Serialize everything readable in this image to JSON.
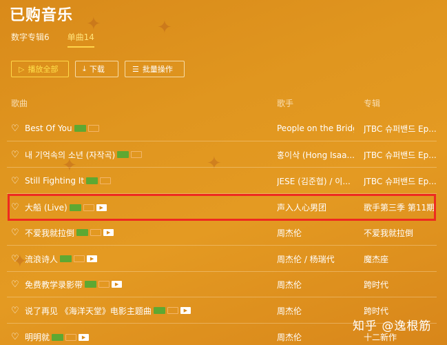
{
  "header": {
    "title": "已购音乐"
  },
  "tabs": [
    {
      "label": "数字专辑6"
    },
    {
      "label": "单曲14"
    }
  ],
  "toolbar": {
    "play_all": "播放全部",
    "download": "下载",
    "batch": "批量操作"
  },
  "columns": {
    "song": "歌曲",
    "singer": "歌手",
    "album": "专辑"
  },
  "songs": [
    {
      "title": "Best Of You",
      "singer": "People on the Bridge",
      "album": "JTBC 슈퍼밴드 Ep..."
    },
    {
      "title": "내 기억속의 소년 (자작곡)",
      "singer": "홍이삭 (Hong Isaa...",
      "album": "JTBC 슈퍼밴드 Ep..."
    },
    {
      "title": "Still Fighting It",
      "singer": "JESE (김준협) / 이...",
      "album": "JTBC 슈퍼밴드 Ep..."
    },
    {
      "title": "大船 (Live)",
      "singer": "声入人心男团",
      "album": "歌手第三季 第11期"
    },
    {
      "title": "不爱我就拉倒",
      "singer": "周杰伦",
      "album": "不爱我就拉倒"
    },
    {
      "title": "流浪诗人",
      "singer": "周杰伦 / 杨瑞代",
      "album": "魔杰座"
    },
    {
      "title": "免费教学录影带",
      "singer": "周杰伦",
      "album": "跨时代"
    },
    {
      "title": "说了再见 《海洋天堂》电影主题曲",
      "singer": "周杰伦",
      "album": "跨时代"
    },
    {
      "title": "明明就",
      "singer": "周杰伦",
      "album": "十二新作"
    }
  ],
  "badges": {
    "vip": "VIP",
    "sq": "SQ",
    "mv": "MV"
  },
  "watermark": "知乎 @逸根筋"
}
